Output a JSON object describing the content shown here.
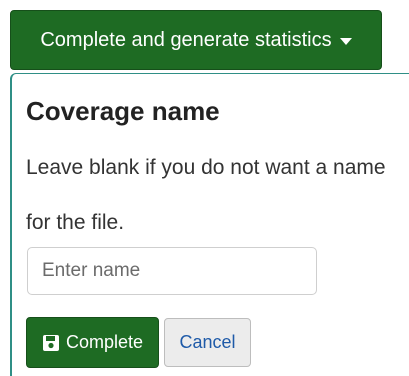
{
  "dropdown": {
    "label": "Complete and generate statistics",
    "caret_icon": "caret-down-icon"
  },
  "popover": {
    "title": "Coverage name",
    "help_text": "Leave blank if you do not want a name for the file.",
    "input": {
      "value": "",
      "placeholder": "Enter name"
    },
    "complete_label": "Complete",
    "complete_icon": "save-icon",
    "cancel_label": "Cancel"
  },
  "colors": {
    "primary_green": "#1e6b23",
    "popover_border": "#2f8f86",
    "cancel_bg": "#ececec",
    "link_blue": "#1e5aa8"
  }
}
